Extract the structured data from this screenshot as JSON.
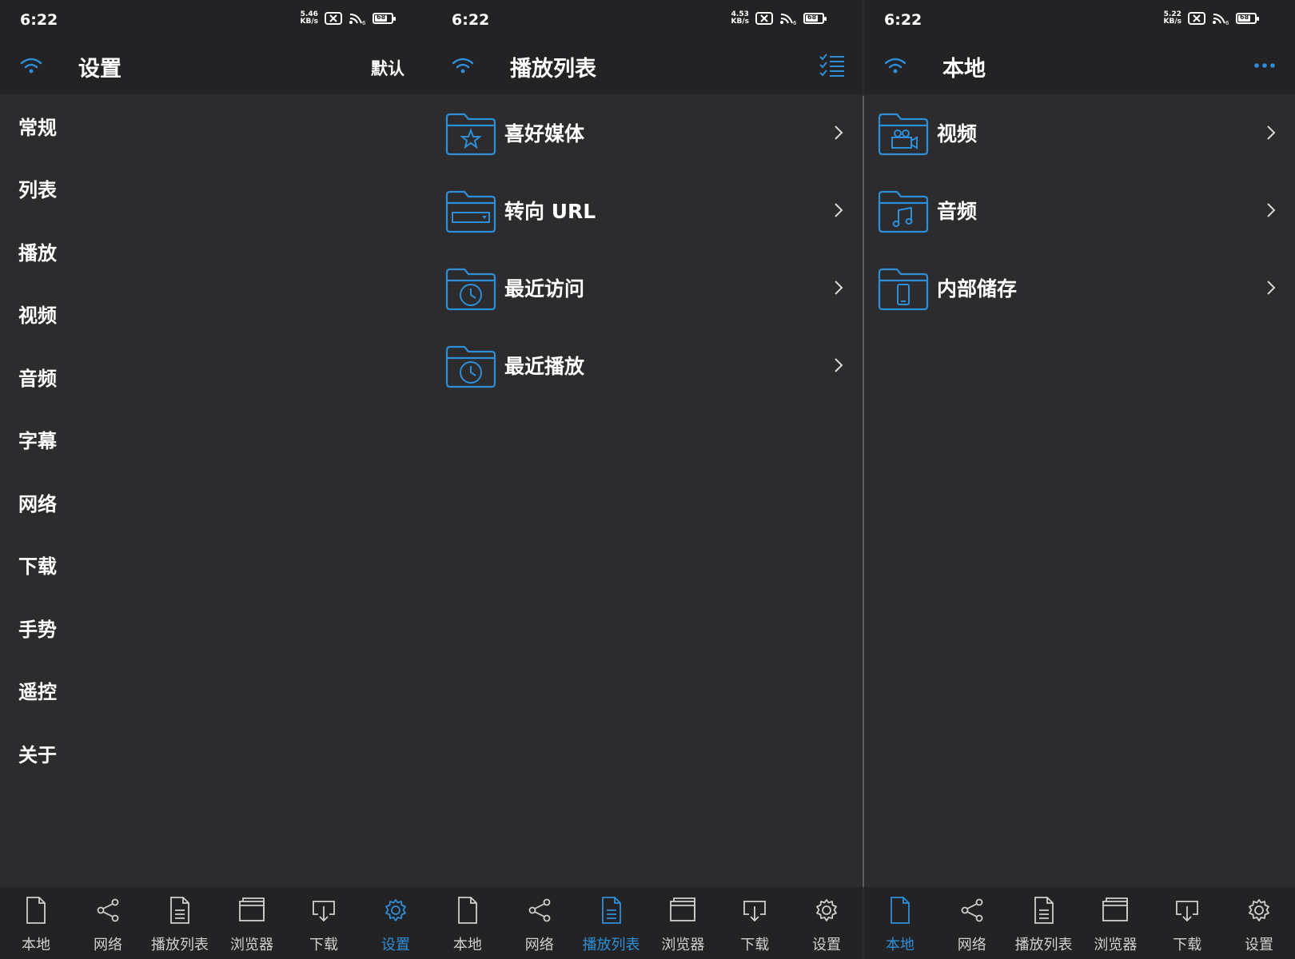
{
  "colors": {
    "accent": "#2f8ed8",
    "background": "#2c2c2e",
    "bar": "#232325",
    "text": "#ffffff",
    "tab_text": "#d0d0d0"
  },
  "panels": [
    {
      "status": {
        "time": "6:22",
        "speed_value": "5.46",
        "speed_unit": "KB/s",
        "battery": "68"
      },
      "header": {
        "icon": "wifi-icon",
        "title": "设置",
        "right_label": "默认"
      },
      "items": [
        "常规",
        "列表",
        "播放",
        "视频",
        "音频",
        "字幕",
        "网络",
        "下载",
        "手势",
        "遥控",
        "关于"
      ]
    },
    {
      "status": {
        "time": "6:22",
        "speed_value": "4.53",
        "speed_unit": "KB/s",
        "battery": "68"
      },
      "header": {
        "icon": "wifi-icon",
        "title": "播放列表",
        "right_icon": "checklist-icon"
      },
      "rows": [
        {
          "label": "喜好媒体",
          "icon": "folder-star-icon"
        },
        {
          "label": "转向 URL",
          "icon": "folder-url-icon"
        },
        {
          "label": "最近访问",
          "icon": "folder-clock-icon"
        },
        {
          "label": "最近播放",
          "icon": "folder-clock-icon"
        }
      ]
    },
    {
      "status": {
        "time": "6:22",
        "speed_value": "5.22",
        "speed_unit": "KB/s",
        "battery": "68"
      },
      "header": {
        "icon": "wifi-icon",
        "title": "本地",
        "right_icon": "more-icon"
      },
      "rows": [
        {
          "label": "视频",
          "icon": "folder-camera-icon"
        },
        {
          "label": "音频",
          "icon": "folder-music-icon"
        },
        {
          "label": "内部储存",
          "icon": "folder-phone-icon"
        }
      ]
    }
  ],
  "tabs": [
    {
      "label": "本地",
      "icon": "file-icon"
    },
    {
      "label": "网络",
      "icon": "share-icon"
    },
    {
      "label": "播放列表",
      "icon": "playlist-icon"
    },
    {
      "label": "浏览器",
      "icon": "browser-icon"
    },
    {
      "label": "下载",
      "icon": "download-icon"
    },
    {
      "label": "设置",
      "icon": "gear-icon"
    }
  ],
  "active_tabs": [
    "设置",
    "播放列表",
    "本地"
  ]
}
